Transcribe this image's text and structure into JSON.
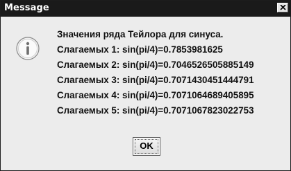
{
  "window": {
    "title": "Message",
    "close_icon": "close-icon"
  },
  "message": {
    "icon": "info-icon",
    "lines": [
      "Значения ряда Тейлора для синуса.",
      "Слагаемых 1:  sin(pi/4)=0.7853981625",
      "Слагаемых 2:  sin(pi/4)=0.7046526505885149",
      "Слагаемых 3:  sin(pi/4)=0.7071430451444791",
      "Слагаемых 4:  sin(pi/4)=0.7071064689405895",
      "Слагаемых 5:  sin(pi/4)=0.7071067823022753"
    ]
  },
  "buttons": {
    "ok_label": "OK"
  }
}
